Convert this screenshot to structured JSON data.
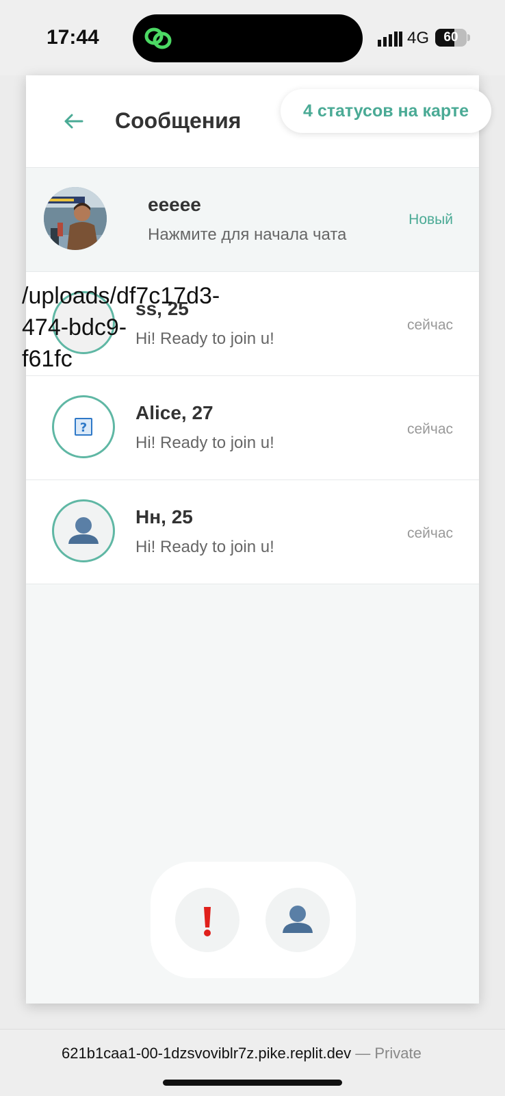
{
  "status_bar": {
    "time": "17:44",
    "network": "4G",
    "battery": "60",
    "battery_level": 0.6
  },
  "header": {
    "title": "Сообщения",
    "back_icon": "arrow-left-icon",
    "status_pill": "4 статусов на карте"
  },
  "chats": [
    {
      "name": "eeeee",
      "preview": "Нажмите для начала чата",
      "meta": "Новый",
      "avatar": "photo-avatar"
    },
    {
      "name": "ss, 25",
      "preview": "Hi! Ready to join u!",
      "meta": "сейчас",
      "broken_image_alt": "/uploads/df7c17d3-\n474-bdc9-\nf61fc",
      "avatar": "broken-image"
    },
    {
      "name": "Alice, 27",
      "preview": "Hi! Ready to join u!",
      "meta": "сейчас",
      "avatar": "question-mark-icon"
    },
    {
      "name": "Нн, 25",
      "preview": "Hi! Ready to join u!",
      "meta": "сейчас",
      "avatar": "person-silhouette-icon"
    }
  ],
  "bottom_nav": {
    "items": [
      {
        "icon": "exclamation-icon"
      },
      {
        "icon": "person-icon"
      }
    ]
  },
  "url_bar": {
    "url": "621b1caa1-00-1dzsvoviblr7z.pike.replit.dev",
    "suffix": " — Private"
  },
  "colors": {
    "accent": "#4aaa95",
    "ring": "#5fb7a4",
    "alert": "#e0201b"
  }
}
